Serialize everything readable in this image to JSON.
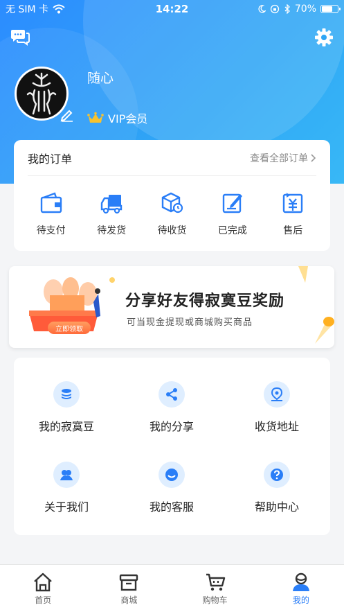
{
  "status_bar": {
    "carrier": "无 SIM 卡",
    "time": "14:22",
    "battery": "70%",
    "battery_level": 0.7
  },
  "profile": {
    "username": "随心",
    "membership": "VIP会员"
  },
  "orders": {
    "title": "我的订单",
    "view_all": "查看全部订单",
    "items": [
      {
        "label": "待支付",
        "icon": "wallet-icon"
      },
      {
        "label": "待发货",
        "icon": "delivery-truck-icon"
      },
      {
        "label": "待收货",
        "icon": "package-icon"
      },
      {
        "label": "已完成",
        "icon": "edit-doc-icon"
      },
      {
        "label": "售后",
        "icon": "yuan-return-icon"
      }
    ]
  },
  "banner": {
    "title": "分享好友得寂寞豆奖励",
    "subtitle": "可当现金提现或商城购买商品",
    "button": "立即领取"
  },
  "features": [
    {
      "label": "我的寂寞豆",
      "icon": "coins-icon"
    },
    {
      "label": "我的分享",
      "icon": "share-icon"
    },
    {
      "label": "收货地址",
      "icon": "location-icon"
    },
    {
      "label": "关于我们",
      "icon": "team-icon"
    },
    {
      "label": "我的客服",
      "icon": "smile-icon"
    },
    {
      "label": "帮助中心",
      "icon": "help-icon"
    }
  ],
  "tabbar": {
    "tabs": [
      {
        "label": "首页",
        "icon": "home-icon"
      },
      {
        "label": "商城",
        "icon": "store-icon"
      },
      {
        "label": "购物车",
        "icon": "cart-icon"
      },
      {
        "label": "我的",
        "icon": "user-icon",
        "active": true
      }
    ]
  },
  "colors": {
    "accent": "#2a7ef7",
    "header_start": "#2c8cff",
    "header_end": "#38b8f6",
    "icon_circle": "#dfeeff"
  }
}
